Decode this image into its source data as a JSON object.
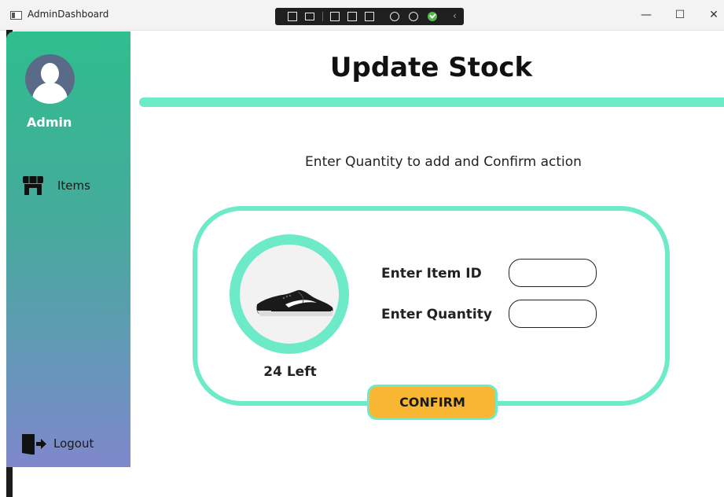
{
  "window": {
    "title": "AdminDashboard",
    "minimize_glyph": "—",
    "maximize_glyph": "☐",
    "close_glyph": "✕"
  },
  "sidebar": {
    "user_label": "Admin",
    "items": [
      {
        "label": "Items",
        "icon": "store-icon"
      }
    ],
    "logout_label": "Logout",
    "gradient_colors": [
      "#2fbe8e",
      "#7f88cb"
    ]
  },
  "main": {
    "title": "Update Stock",
    "instruction": "Enter Quantity to add and Confirm action",
    "stock_text": "24 Left",
    "fields": [
      {
        "label": "Enter Item ID",
        "value": ""
      },
      {
        "label": "Enter Quantity",
        "value": ""
      }
    ],
    "confirm_label": "CONFIRM"
  },
  "colors": {
    "accent": "#6debc8",
    "button": "#f7b732"
  }
}
